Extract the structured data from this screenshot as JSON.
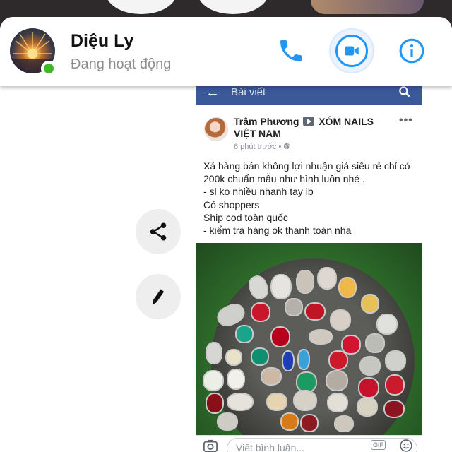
{
  "header": {
    "contact_name": "Diệu Ly",
    "status": "Đang hoạt động",
    "online": true
  },
  "header_actions": {
    "call": "phone-icon",
    "video": "video-camera-icon",
    "info": "info-icon"
  },
  "side_actions": [
    "share-icon",
    "pencil-icon"
  ],
  "colors": {
    "accent": "#2196f3",
    "online": "#42b72a",
    "facebook_bar": "#3b5998"
  },
  "shared_post": {
    "nav_title": "Bài viết",
    "author": "Trâm Phương",
    "page_name": "XÓM NAILS VIỆT NAM",
    "timestamp": "6 phút trước",
    "text_lines": [
      "Xả hàng bán không lợi nhuận giá siêu rẻ chỉ có",
      "200k chuẩn mẫu như hình luôn nhé .",
      "- sl ko nhiều nhanh tay ib",
      "Có shoppers",
      "Ship cod toàn quốc",
      "- kiểm tra hàng ok thanh toán nha"
    ],
    "comment_placeholder": "Viết bình luận...",
    "gif_label": "GIF"
  }
}
